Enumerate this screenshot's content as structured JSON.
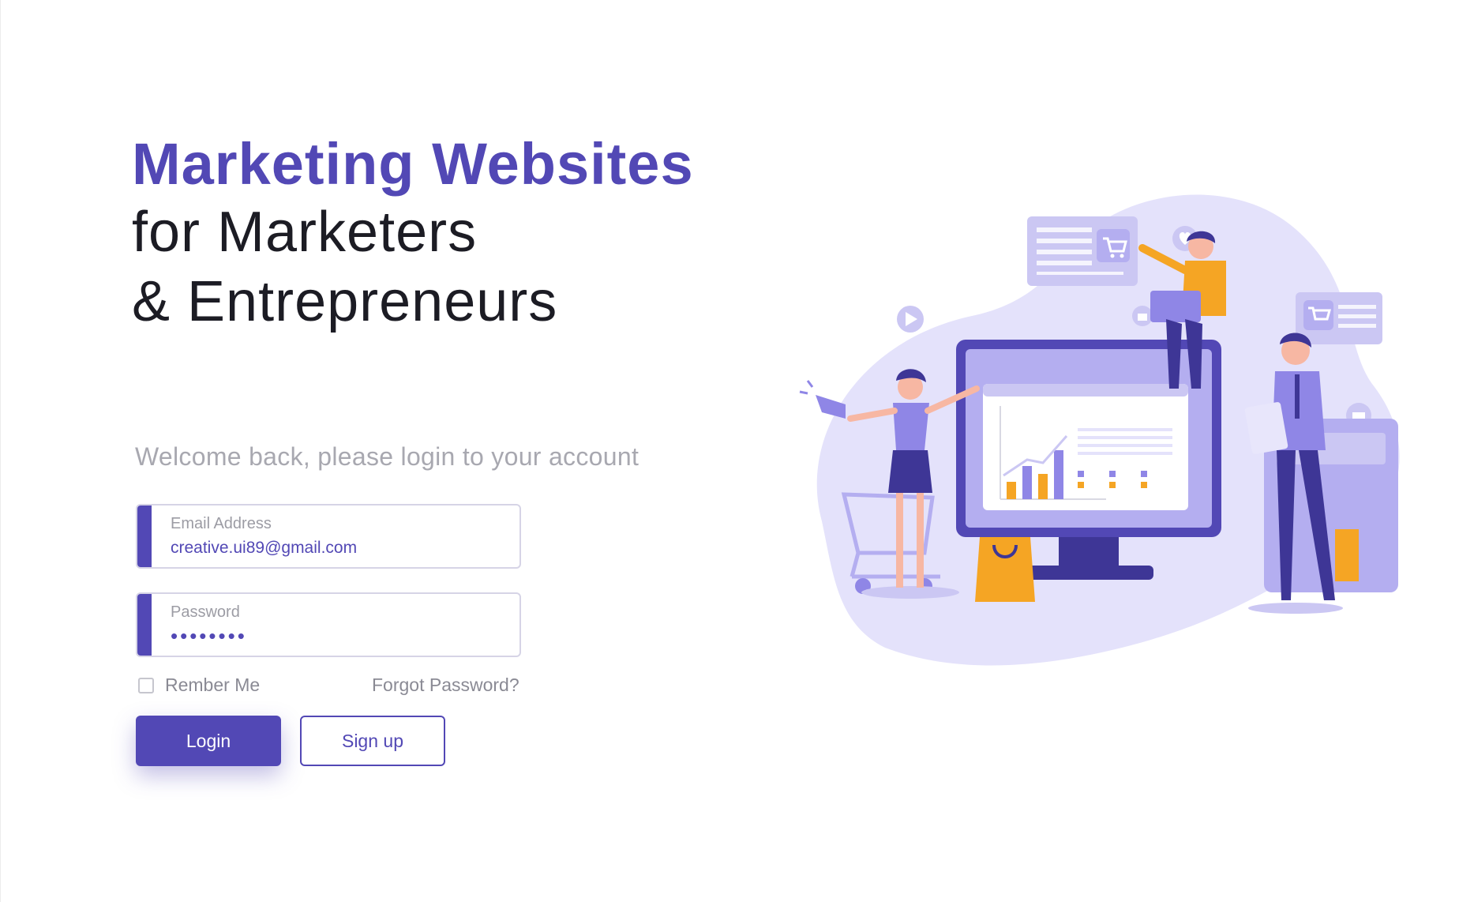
{
  "hero": {
    "title": "Marketing Websites",
    "line1": "for Marketers",
    "line2": "& Entrepreneurs"
  },
  "form": {
    "welcome": "Welcome back, please login to your account",
    "email": {
      "label": "Email Address",
      "value": "creative.ui89@gmail.com"
    },
    "password": {
      "label": "Password",
      "masked_value": "••••••••"
    },
    "remember_label": "Rember Me",
    "forgot_label": "Forgot Password?",
    "login_label": "Login",
    "signup_label": "Sign up"
  },
  "colors": {
    "brand": "#5248b5",
    "light_purple": "#e4e2fb",
    "orange": "#f5a524"
  },
  "illustration": {
    "icons": [
      "play-icon",
      "heart-icon",
      "thumbs-up-icon",
      "cart-icon",
      "megaphone-icon",
      "bar-chart-icon",
      "shopping-bag-icon",
      "laptop-icon",
      "calculator-icon"
    ]
  }
}
